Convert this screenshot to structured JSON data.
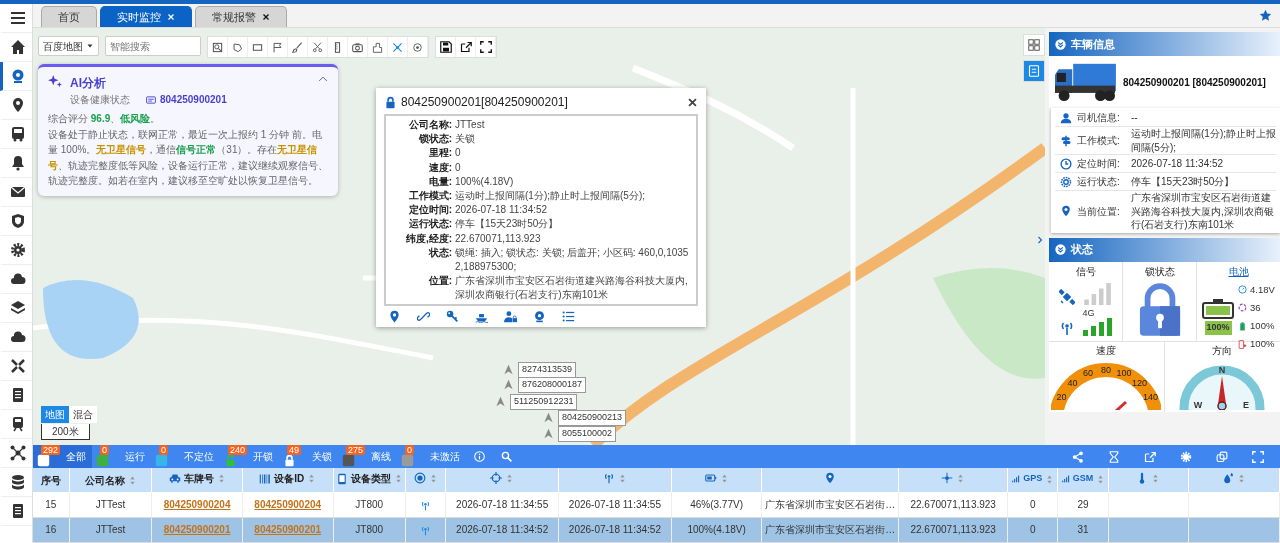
{
  "sidebar": {
    "items": [
      {
        "selected": false
      },
      {
        "selected": false
      },
      {
        "selected": true
      },
      {
        "selected": false
      },
      {
        "selected": false
      },
      {
        "selected": false
      },
      {
        "selected": false
      },
      {
        "selected": false
      },
      {
        "selected": false
      },
      {
        "selected": false
      },
      {
        "selected": false
      },
      {
        "selected": false
      },
      {
        "selected": false
      },
      {
        "selected": false
      },
      {
        "selected": false
      },
      {
        "selected": false
      },
      {
        "selected": false
      },
      {
        "selected": false
      }
    ]
  },
  "tabs": [
    {
      "label": "首页",
      "selected": false,
      "closable": false
    },
    {
      "label": "实时监控",
      "selected": true,
      "closable": true
    },
    {
      "label": "常规报警",
      "selected": false,
      "closable": true
    }
  ],
  "map": {
    "map_type": "百度地图",
    "search_placeholder": "智能搜索",
    "tools": [
      {
        "selected": false
      },
      {
        "selected": false
      },
      {
        "selected": false
      },
      {
        "selected": false
      },
      {
        "selected": false
      },
      {
        "selected": false
      },
      {
        "selected": false
      },
      {
        "selected": false
      },
      {
        "selected": false
      },
      {
        "selected": true
      },
      {
        "selected": false
      }
    ],
    "markers": [
      {
        "label": "8274313539"
      },
      {
        "label": "876208000187"
      },
      {
        "label": "511250912231"
      },
      {
        "label": "804250900213"
      },
      {
        "label": "8055100002"
      }
    ],
    "layer_buttons": [
      {
        "label": "地图",
        "selected": true
      },
      {
        "label": "混合",
        "selected": false
      }
    ],
    "scale": "200米",
    "side_buttons": [
      {
        "selected": false
      },
      {
        "selected": true
      }
    ]
  },
  "ai_panel": {
    "title": "AI分析",
    "subtitle": "设备健康状态",
    "device_id": "804250900201",
    "expanded": true,
    "paragraphs": [
      [
        {
          "text": "综合评分 "
        },
        {
          "text": "96.9",
          "color": "#18a04b"
        },
        {
          "text": "、"
        },
        {
          "text": "低风险",
          "color": "#18a04b"
        },
        {
          "text": "。"
        }
      ],
      [
        {
          "text": "设备处于静止状态，联网正常，最近一次上报约 1 分钟 前。电量 100%。"
        },
        {
          "text": "无卫星信号",
          "color": "#c99300"
        },
        {
          "text": "，通信"
        },
        {
          "text": "信号正常",
          "color": "#18a04b"
        },
        {
          "text": "（31）。存在"
        },
        {
          "text": "无卫星信号",
          "color": "#c99300"
        },
        {
          "text": "、轨迹完整度低等风险，设备运行正常，建议继续观察信号、轨迹完整度。如若在室内，建议移至空旷处以恢复卫星信号。"
        }
      ]
    ]
  },
  "popup": {
    "title": "804250900201[804250900201]",
    "locked": true,
    "fields": [
      {
        "label": "公司名称:",
        "value": "JTTest"
      },
      {
        "label": "锁状态:",
        "value": "关锁"
      },
      {
        "label": "里程:",
        "value": "0"
      },
      {
        "label": "速度:",
        "value": "0"
      },
      {
        "label": "电量:",
        "value": "100%(4.18V)"
      },
      {
        "label": "工作模式:",
        "value": "运动时上报间隔(1分);静止时上报间隔(5分);"
      },
      {
        "label": "定位时间:",
        "value": "2026-07-18 11:34:52"
      },
      {
        "label": "运行状态:",
        "value": "停车【15天23时50分】"
      },
      {
        "label": "纬度,经度:",
        "value": "22.670071,113.923"
      },
      {
        "label": "状态:",
        "value": "锁绳: 插入; 锁状态: 关锁; 后盖开; 小区码: 460,0,10352,188975300;"
      },
      {
        "label": "位置:",
        "value": "广东省深圳市宝安区石岩街道建兴路海谷科技大厦内,深圳农商银行(石岩支行)东南101米"
      }
    ]
  },
  "vehicle_info": {
    "title": "车辆信息",
    "plate": "804250900201 [804250900201]",
    "rows": [
      {
        "label": "司机信息:",
        "value": "--"
      },
      {
        "label": "工作模式:",
        "value": "运动时上报间隔(1分);静止时上报间隔(5分);"
      },
      {
        "label": "定位时间:",
        "value": "2026-07-18 11:34:52"
      },
      {
        "label": "运行状态:",
        "value": "停车【15天23时50分】"
      },
      {
        "label": "当前位置:",
        "value": "广东省深圳市宝安区石岩街道建兴路海谷科技大厦内,深圳农商银行(石岩支行)东南101米"
      }
    ]
  },
  "status": {
    "title": "状态",
    "signal": {
      "label": "信号",
      "network": "4G"
    },
    "lock": {
      "label": "锁状态",
      "locked": true
    },
    "battery": {
      "label": "电池",
      "level": 1.0,
      "percent": "100%",
      "readings": [
        "4.18V",
        "36",
        "100%",
        "100%"
      ]
    },
    "speed": {
      "label": "速度",
      "ticks": [
        "20",
        "40",
        "60",
        "80",
        "100",
        "120",
        "140"
      ]
    },
    "direction": {
      "label": "方向",
      "north": "N",
      "west": "W",
      "east": "E"
    }
  },
  "filters": [
    {
      "label": "全部",
      "count": "292",
      "kind": "square",
      "color": "#ffffff",
      "selected": true
    },
    {
      "label": "运行",
      "count": "0",
      "kind": "square",
      "color": "#3cb043",
      "selected": false
    },
    {
      "label": "不定位",
      "count": "0",
      "kind": "square",
      "color": "#35b5e8",
      "selected": false
    },
    {
      "label": "开锁",
      "count": "240",
      "kind": "lock-open",
      "color": "#2fbf3c",
      "selected": false
    },
    {
      "label": "关锁",
      "count": "49",
      "kind": "lock-closed",
      "color": "#ffffff",
      "selected": false
    },
    {
      "label": "离线",
      "count": "275",
      "kind": "square",
      "color": "#555555",
      "selected": false
    },
    {
      "label": "未激活",
      "count": "0",
      "kind": "square",
      "color": "#9a9a9a",
      "selected": false
    }
  ],
  "table": {
    "columns": [
      {
        "label": "序号",
        "sortable": false
      },
      {
        "label": "公司名称",
        "sortable": true
      },
      {
        "label": "车牌号",
        "sortable": true
      },
      {
        "label": "设备ID",
        "sortable": true
      },
      {
        "label": "设备类型",
        "sortable": true
      },
      {
        "sortable": true
      },
      {
        "sortable": true
      },
      {
        "sortable": true
      },
      {
        "sortable": true
      },
      {
        "sortable": false
      },
      {
        "sortable": true
      },
      {
        "label": "GPS",
        "sortable": true
      },
      {
        "label": "GSM",
        "sortable": true
      },
      {
        "sortable": true
      },
      {
        "sortable": true
      }
    ],
    "rows": [
      {
        "selected": false,
        "no": "15",
        "company": "JTTest",
        "plate": "804250900204",
        "device_id": "804250900204",
        "device_type": "JT800",
        "gps_time": "2026-07-18 11:34:55",
        "recv_time": "2026-07-18 11:34:55",
        "battery": "46%(3.77V)",
        "location": "广东省深圳市宝安区石岩街…",
        "latlng": "22.670071,113.923",
        "gps": "0",
        "gsm": "29"
      },
      {
        "selected": true,
        "no": "16",
        "company": "JTTest",
        "plate": "804250900201",
        "device_id": "804250900201",
        "device_type": "JT800",
        "gps_time": "2026-07-18 11:34:52",
        "recv_time": "2026-07-18 11:34:52",
        "battery": "100%(4.18V)",
        "location": "广东省深圳市宝安区石岩街…",
        "latlng": "22.670071,113.923",
        "gps": "0",
        "gsm": "31"
      }
    ]
  }
}
